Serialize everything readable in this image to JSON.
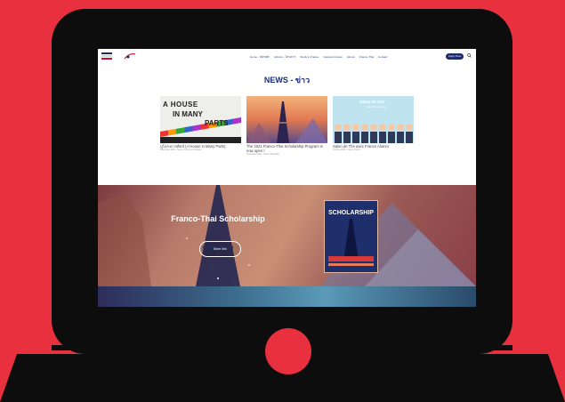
{
  "header": {
    "nav_items": [
      "Home - หน้าหลัก",
      "Actions - โครงการ",
      "Study in France",
      "Campus France",
      "Alumni",
      "Franco-Thai",
      "Contact"
    ],
    "cta": "Apply Now"
  },
  "news": {
    "title": "NEWS - ข่าว",
    "cards": [
      {
        "image_text": [
          "A HOUSE",
          "IN MANY",
          "PARTS"
        ],
        "title": "ปูโครงการศิลป์ (A House in Many Parts)",
        "meta": "November 2021 - News, Culture and Media"
      },
      {
        "title": "The 2021 Franco-Thai Scholarship Program is now open !",
        "meta": "November 2021 - News, Education"
      },
      {
        "image_title": "Salon de Thé",
        "image_sub": "avec France Alumni",
        "title": "Salon de Thé avec France Alumni",
        "meta": "October 2021 - News, Alumni"
      }
    ]
  },
  "hero": {
    "title": "Franco-Thai Scholarship",
    "subtitle": "",
    "button": "More Info",
    "poster_label": "SCHOLARSHIP"
  },
  "colors": {
    "background": "#e8303f",
    "laptop": "#0d0d0d",
    "brand_blue": "#1c2d78"
  }
}
